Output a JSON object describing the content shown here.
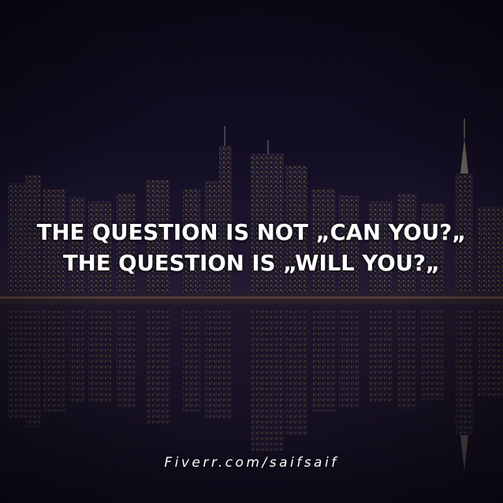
{
  "background": {
    "description_icon": "city-skyline-night-reflection",
    "colors": {
      "sky_top": "#0f0b1c",
      "sky_mid": "#1a1430",
      "building_dark": "#1f1a2e",
      "light_warm": "#e8b56a",
      "light_cool": "#cfd6e8",
      "water": "#120e20"
    }
  },
  "quote": {
    "line1": "THE QUESTION IS NOT „CAN YOU?„",
    "line2": "THE QUESTION IS „WILL YOU?„"
  },
  "credit": {
    "text": "Fiverr.com/saifsaif"
  }
}
